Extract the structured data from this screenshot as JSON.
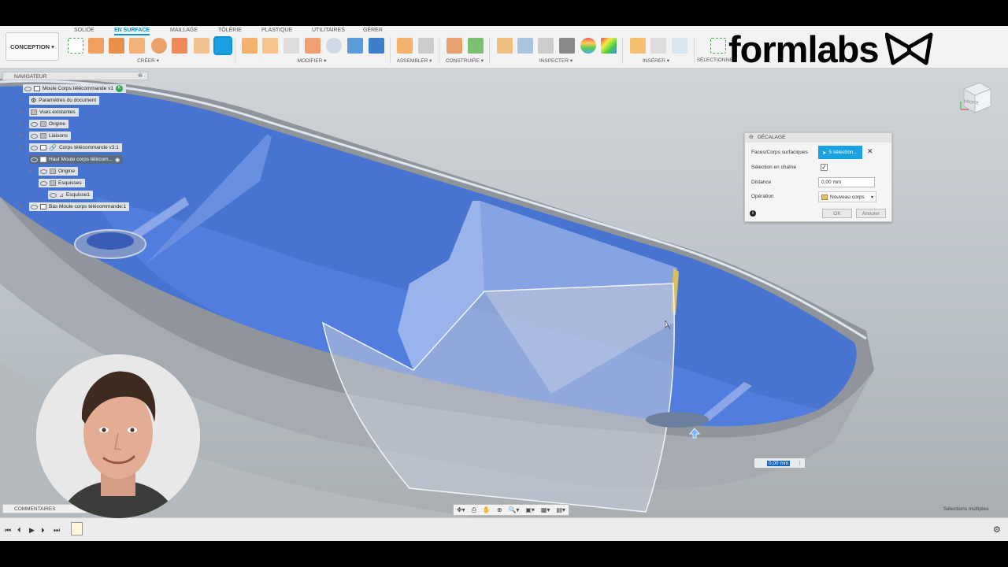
{
  "workspace": {
    "label": "CONCEPTION ▾"
  },
  "tabs": [
    {
      "label": "SOLIDE"
    },
    {
      "label": "EN SURFACE"
    },
    {
      "label": "MAILLAGE"
    },
    {
      "label": "TÔLERIE"
    },
    {
      "label": "PLASTIQUE"
    },
    {
      "label": "UTILITAIRES"
    },
    {
      "label": "GÉRER"
    }
  ],
  "groups": [
    {
      "label": "CRÉER ▾"
    },
    {
      "label": "MODIFIER ▾"
    },
    {
      "label": "ASSEMBLER ▾"
    },
    {
      "label": "CONSTRUIRE ▾"
    },
    {
      "label": "INSPECTER ▾"
    },
    {
      "label": "INSÉRER ▾"
    },
    {
      "label": "SÉLECTIONNER"
    }
  ],
  "brand": {
    "name": "formlabs"
  },
  "navigator": {
    "title": "NAVIGATEUR",
    "items": [
      {
        "label": "Moule Corps télécommande v1"
      },
      {
        "label": "Paramètres du document"
      },
      {
        "label": "Vues existantes"
      },
      {
        "label": "Origine"
      },
      {
        "label": "Liaisons"
      },
      {
        "label": "Corps télécommande v3:1"
      },
      {
        "label": "Haut Moule corps télécom..."
      },
      {
        "label": "Origine"
      },
      {
        "label": "Esquisses"
      },
      {
        "label": "Esquisse1"
      },
      {
        "label": "Bas Moule corps télécommande:1"
      }
    ]
  },
  "offset_panel": {
    "title": "DÉCALAGE",
    "faces_label": "Faces/Corps surfaciques",
    "faces_value": "5 sélection...",
    "chain_label": "Sélection en chaîne",
    "chain_checked": "✓",
    "distance_label": "Distance",
    "distance_value": "0,00 mm",
    "operation_label": "Opération",
    "operation_value": "Nouveau corps",
    "ok_label": "OK",
    "cancel_label": "Annuler"
  },
  "distance_overlay": {
    "value": "0,00 mm"
  },
  "viewcube": {
    "label": "DROITE"
  },
  "comments": {
    "label": "COMMENTAIRES"
  },
  "status": {
    "multi_selection": "Sélections multiples"
  },
  "colors": {
    "selection_blue": "#3f6fd8",
    "accent": "#0696d7"
  }
}
